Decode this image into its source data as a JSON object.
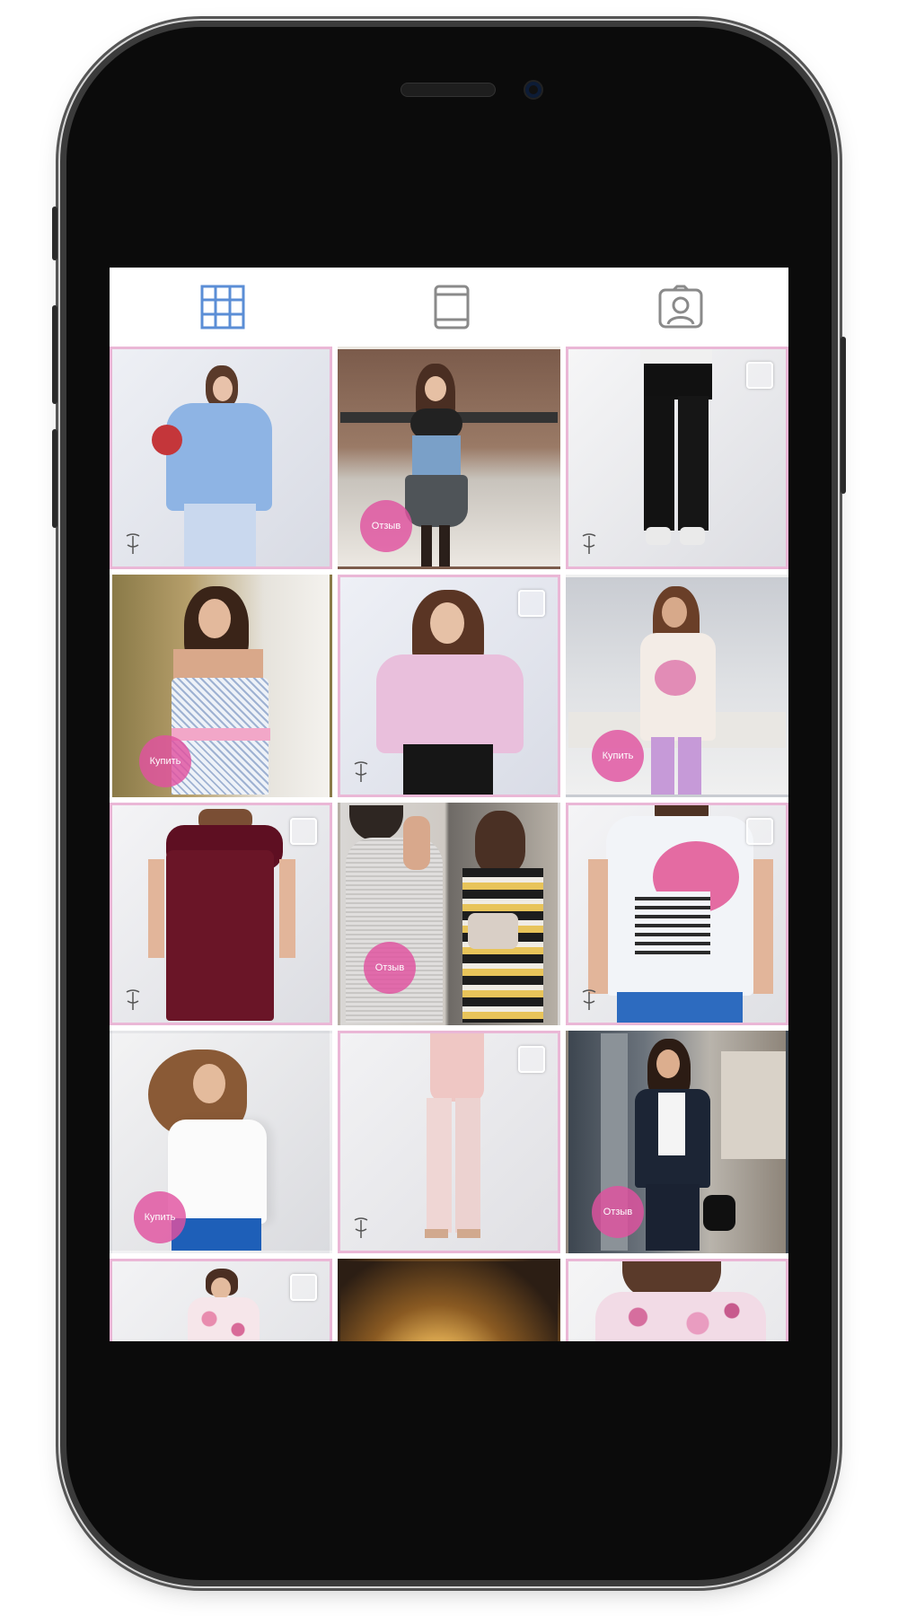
{
  "device": {
    "frame_color": "#0b0b0b",
    "screen_bg": "#ffffff"
  },
  "tabs": [
    {
      "icon": "grid-icon",
      "active": true,
      "color": "#5b8ed6"
    },
    {
      "icon": "tablet-icon",
      "active": false,
      "color": "#8a8a8a"
    },
    {
      "icon": "profile-icon",
      "active": false,
      "color": "#8a8a8a"
    }
  ],
  "accent_border": "#eab7d6",
  "tag_color": "#e052a0",
  "tiles": [
    {
      "desc": "woman in blue off-shoulder blouse with embroidered sleeves",
      "tag": ""
    },
    {
      "desc": "woman on street in denim top and floral skirt",
      "tag": "Отзыв"
    },
    {
      "desc": "black slim trousers",
      "tag": ""
    },
    {
      "desc": "woman in white dotted top with pink belt",
      "tag": "Купить"
    },
    {
      "desc": "woman in pink ruffled blouse",
      "tag": ""
    },
    {
      "desc": "woman in white floral tunic and lilac leggings",
      "tag": "Купить"
    },
    {
      "desc": "burgundy shift dress",
      "tag": ""
    },
    {
      "desc": "collage of grey dress and striped dress",
      "tag": "Отзыв"
    },
    {
      "desc": "white t-shirt with pink rose print",
      "tag": ""
    },
    {
      "desc": "woman in white top and blue jeans",
      "tag": "Купить"
    },
    {
      "desc": "pale pink trouser suit",
      "tag": ""
    },
    {
      "desc": "woman in navy jacket on street",
      "tag": "Отзыв"
    },
    {
      "desc": "woman in floral summer top",
      "tag": ""
    },
    {
      "desc": "warm toned abstract photo",
      "tag": ""
    },
    {
      "desc": "pink floral blouse back view",
      "tag": ""
    }
  ]
}
